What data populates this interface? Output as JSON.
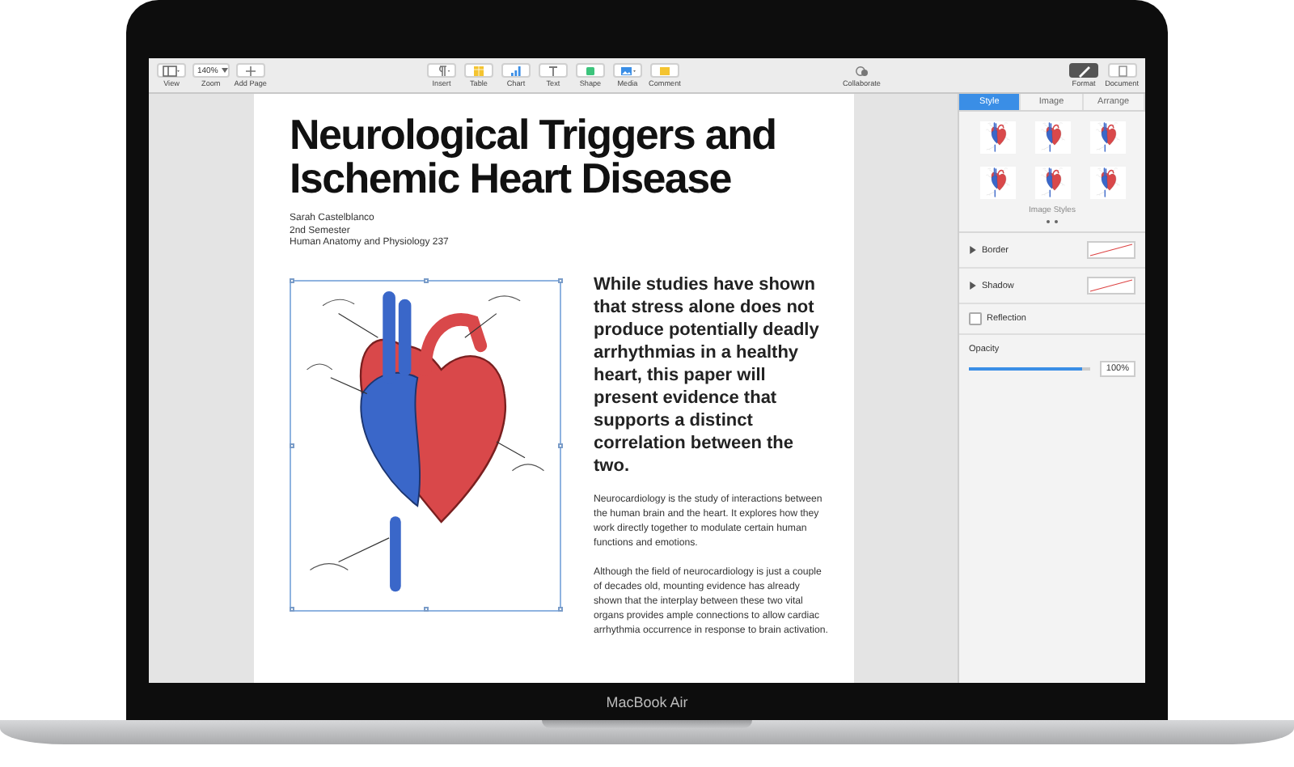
{
  "toolbar": {
    "left": [
      {
        "kind": "view",
        "label": "View"
      },
      {
        "kind": "zoom",
        "label": "Zoom",
        "value": "140%"
      },
      {
        "kind": "plus",
        "label": "Add Page"
      }
    ],
    "center": [
      {
        "kind": "pilcrow",
        "label": "Insert"
      },
      {
        "kind": "table",
        "label": "Table"
      },
      {
        "kind": "chart",
        "label": "Chart"
      },
      {
        "kind": "text",
        "label": "Text"
      },
      {
        "kind": "shape",
        "label": "Shape"
      },
      {
        "kind": "media",
        "label": "Media"
      },
      {
        "kind": "comment",
        "label": "Comment"
      }
    ],
    "collaborate": "Collaborate",
    "inspector_buttons": [
      {
        "kind": "format",
        "label": "Format",
        "selected": true
      },
      {
        "kind": "document",
        "label": "Document",
        "selected": false
      }
    ]
  },
  "document": {
    "title": "Neurological Triggers and Ischemic Heart Disease",
    "author_lines": [
      "Sarah Castelblanco",
      "2nd Semester",
      "Human Anatomy and Physiology 237"
    ],
    "lead": "While studies have shown that stress alone does not produce potentially deadly arrhythmias in a healthy heart, this paper will present evidence that supports a distinct correlation between the two.",
    "paragraphs": [
      "Neurocardiology is the study of interactions between the human brain and the heart. It explores how they work directly together to modulate certain human functions and emotions.",
      "Although the field of neurocardiology is just a couple of decades old, mounting evidence has already shown that the interplay between these two vital organs provides ample connections to allow cardiac arrhythmia occurrence in response to brain activation."
    ]
  },
  "inspector": {
    "tabs": [
      {
        "label": "Style",
        "selected": true
      },
      {
        "label": "Image",
        "selected": false
      },
      {
        "label": "Arrange",
        "selected": false
      }
    ],
    "styles_caption": "Image Styles",
    "rows": [
      {
        "kind": "swatch",
        "label": "Border",
        "expanded": false
      },
      {
        "kind": "swatch",
        "label": "Shadow",
        "expanded": false
      },
      {
        "kind": "checkbox",
        "label": "Reflection",
        "checked": false
      },
      {
        "kind": "slider",
        "label": "Opacity",
        "level": 0.93,
        "reading": "100%"
      }
    ]
  },
  "device_label": "MacBook Air"
}
